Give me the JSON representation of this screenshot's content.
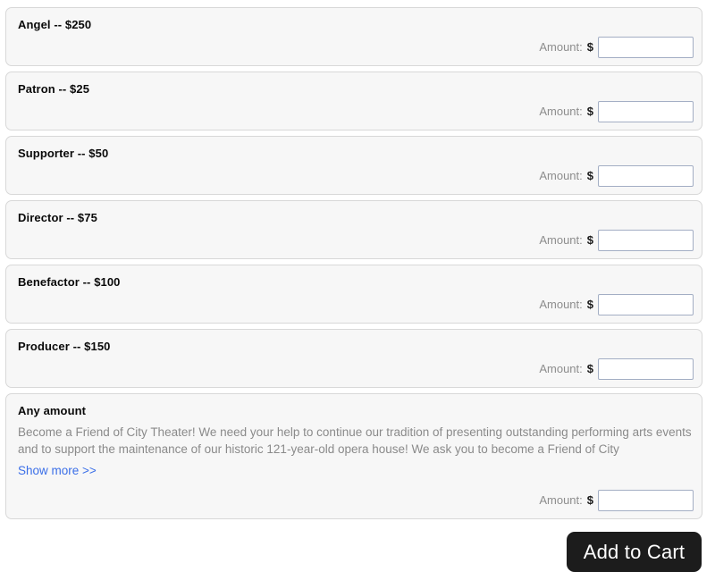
{
  "donation_levels": [
    {
      "title": "Angel -- $250",
      "amount_label": "Amount:",
      "currency": "$",
      "value": "",
      "placeholder": ""
    },
    {
      "title": "Patron -- $25",
      "amount_label": "Amount:",
      "currency": "$",
      "value": "",
      "placeholder": ""
    },
    {
      "title": "Supporter -- $50",
      "amount_label": "Amount:",
      "currency": "$",
      "value": "",
      "placeholder": ""
    },
    {
      "title": "Director -- $75",
      "amount_label": "Amount:",
      "currency": "$",
      "value": "",
      "placeholder": ""
    },
    {
      "title": "Benefactor -- $100",
      "amount_label": "Amount:",
      "currency": "$",
      "value": "",
      "placeholder": ""
    },
    {
      "title": "Producer -- $150",
      "amount_label": "Amount:",
      "currency": "$",
      "value": "",
      "placeholder": ""
    }
  ],
  "any_amount": {
    "title": "Any amount",
    "description": "Become a Friend of City Theater! We need your help to continue our tradition of presenting outstanding performing arts events and to support the maintenance of our historic 121-year-old opera house! We ask you to become a Friend of City",
    "show_more_label": "Show more >>",
    "amount_label": "Amount:",
    "currency": "$",
    "value": "",
    "placeholder": ""
  },
  "footer": {
    "add_to_cart_label": "Add to Cart"
  },
  "colors": {
    "panel_background": "#f7f7f7",
    "panel_border": "#d8d8d8",
    "title_text": "#0a0a0a",
    "muted_text": "#8a8a8a",
    "link": "#3b6fe8",
    "input_border": "#a3aec4",
    "button_background": "#1c1c1c",
    "button_text": "#ffffff"
  }
}
